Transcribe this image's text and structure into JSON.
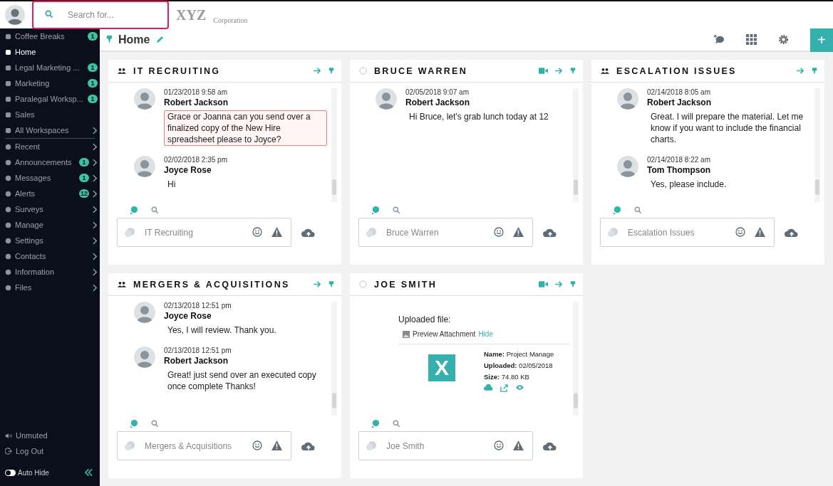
{
  "topbar": {
    "search": {
      "placeholder": "Search for..."
    },
    "logo": {
      "mark": "XYZ",
      "name": "Corporation"
    }
  },
  "sidebar": {
    "items": [
      {
        "label": "Coffee Breaks",
        "badge": "1",
        "submenu": false,
        "selected": false
      },
      {
        "label": "Home",
        "submenu": false,
        "selected": true
      },
      {
        "label": "Legal Marketing ...",
        "badge": "1",
        "submenu": false,
        "selected": false
      },
      {
        "label": "Marketing",
        "badge": "1",
        "submenu": false,
        "selected": false
      },
      {
        "label": "Paralegal Worksp...",
        "badge": "1",
        "submenu": false,
        "selected": false
      },
      {
        "label": "Sales",
        "submenu": false,
        "selected": false
      },
      {
        "label": "All Workspaces",
        "submenu": true,
        "selected": false
      }
    ],
    "menu": [
      {
        "label": "Recent",
        "submenu": true
      },
      {
        "label": "Announcements",
        "badge": "1",
        "submenu": true
      },
      {
        "label": "Messages",
        "badge": "1",
        "submenu": true
      },
      {
        "label": "Alerts",
        "badge": "12",
        "submenu": true
      },
      {
        "label": "Surveys",
        "submenu": true
      },
      {
        "label": "Manage",
        "submenu": true
      },
      {
        "label": "Settings",
        "submenu": true
      },
      {
        "label": "Contacts",
        "submenu": true
      },
      {
        "label": "Information",
        "submenu": true
      },
      {
        "label": "Files",
        "submenu": true
      }
    ],
    "footer": [
      {
        "label": "Unmuted"
      },
      {
        "label": "Log Out"
      }
    ],
    "auto_hide": {
      "label": "Auto Hide",
      "on": false
    }
  },
  "header": {
    "title": "Home",
    "add_label": "+"
  },
  "panels": [
    {
      "kind": "group",
      "title": "IT RECRUITING",
      "placeholder": "IT Recruiting",
      "messages": [
        {
          "kind": "text",
          "date": "01/23/2018 9:58 am",
          "author": "Robert Jackson",
          "text": "Grace or Joanna can you send over a finalized copy of the New Hire spreadsheet please to Joyce?",
          "highlighted": true
        },
        {
          "kind": "text",
          "date": "02/02/2018 2:35 pm",
          "author": "Joyce Rose",
          "text": "Hi",
          "highlighted": false
        }
      ]
    },
    {
      "kind": "direct",
      "title": "BRUCE WARREN",
      "placeholder": "Bruce Warren",
      "messages": [
        {
          "kind": "text",
          "date": "02/05/2018 9:07 am",
          "author": "Robert Jackson",
          "text": "Hi Bruce, let's grab lunch today at 12",
          "highlighted": false
        }
      ]
    },
    {
      "kind": "group",
      "title": "ESCALATION ISSUES",
      "placeholder": "Escalation Issues",
      "messages": [
        {
          "kind": "text",
          "date": "02/14/2018 8:05 am",
          "author": "Robert Jackson",
          "text": "Great.  I will prepare the material.  Let me know if you want to include the financial charts.",
          "highlighted": false
        },
        {
          "kind": "text",
          "date": "02/14/2018 8:22 am",
          "author": "Tom Thompson",
          "text": "Yes, please include.",
          "highlighted": false
        }
      ]
    },
    {
      "kind": "group",
      "title": "MERGERS & ACQUISITIONS",
      "placeholder": "Mergers & Acquisitions",
      "messages": [
        {
          "kind": "text",
          "date": "02/13/2018 12:51 pm",
          "author": "Joyce Rose",
          "text": "Yes, I will review.  Thank you.",
          "highlighted": false
        },
        {
          "kind": "text",
          "date": "02/13/2018 12:51 pm",
          "author": "Robert Jackson",
          "text": "Great! just send over an executed copy once complete Thanks!",
          "highlighted": false
        }
      ]
    },
    {
      "kind": "direct",
      "title": "JOE SMITH",
      "placeholder": "Joe Smith",
      "messages": [
        {
          "kind": "file",
          "heading": "Uploaded file:",
          "preview": "Preview Attachment",
          "hide": "Hide",
          "badge": "X",
          "fields": [
            {
              "label": "Name:",
              "value": "Project Manage"
            },
            {
              "label": "Uploaded:",
              "value": "02/05/2018"
            },
            {
              "label": "Size:",
              "value": "74.80 KB"
            }
          ]
        }
      ]
    }
  ]
}
